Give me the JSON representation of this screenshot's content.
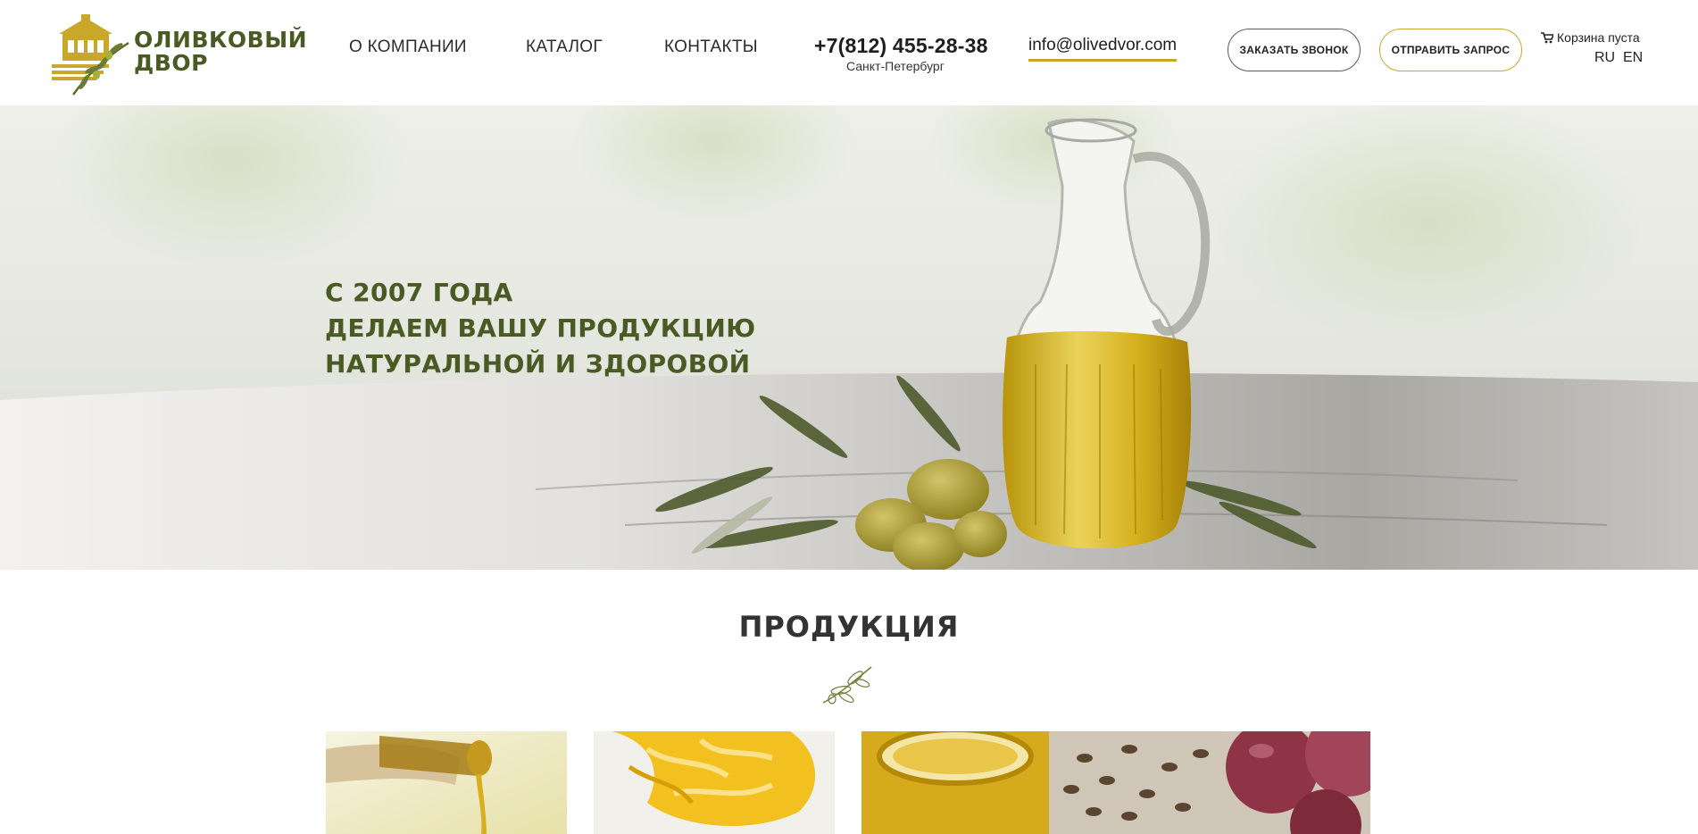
{
  "brand": {
    "line1": "ОЛИВКОВЫЙ",
    "line2": "ДВОР"
  },
  "nav": [
    {
      "label": "О КОМПАНИИ"
    },
    {
      "label": "КАТАЛОГ"
    },
    {
      "label": "КОНТАКТЫ"
    }
  ],
  "contact": {
    "phone": "+7(812) 455-28-38",
    "city": "Санкт-Петербург",
    "email": "info@olivedvor.com"
  },
  "buttons": {
    "call": "ЗАКАЗАТЬ ЗВОНОК",
    "request": "ОТПРАВИТЬ ЗАПРОС"
  },
  "cart": {
    "label": "Корзина пуста",
    "icon": "cart-icon"
  },
  "lang": [
    {
      "label": "RU"
    },
    {
      "label": "EN"
    }
  ],
  "hero": {
    "line1": "С 2007 ГОДА",
    "line2": "ДЕЛАЕМ ВАШУ ПРОДУКЦИЮ",
    "line3": "НАТУРАЛЬНОЙ И ЗДОРОВОЙ"
  },
  "products": {
    "title": "ПРОДУКЦИЯ",
    "items": [
      {
        "image": "pouring-olive-oil-photo"
      },
      {
        "image": "yellow-fat-photo"
      },
      {
        "image": "oil-jar-grape-seeds-photo"
      }
    ]
  },
  "colors": {
    "accent": "#c9a72a",
    "brand_green": "#4a5a23",
    "text": "#2b2b2b"
  }
}
